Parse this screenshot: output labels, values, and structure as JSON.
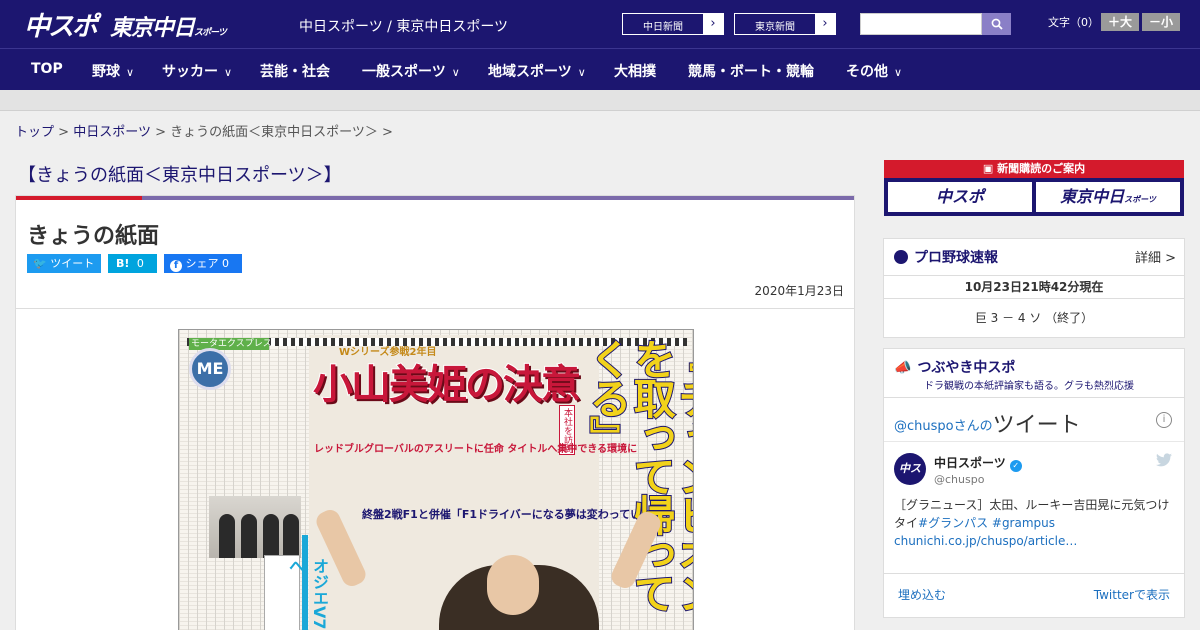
{
  "header": {
    "logo_main": "中スポ",
    "logo_sub": "東京中日",
    "logo_sub_small": "スポーツ",
    "tagline": "中日スポーツ / 東京中日スポーツ",
    "ext_links": [
      {
        "label": "中日新聞"
      },
      {
        "label": "東京新聞"
      }
    ],
    "search_placeholder": "",
    "font_size_label": "文字（0）",
    "font_larger": "＋大",
    "font_smaller": "－小"
  },
  "nav": {
    "items": [
      {
        "label": "TOP",
        "dropdown": false
      },
      {
        "label": "野球",
        "dropdown": true
      },
      {
        "label": "サッカー",
        "dropdown": true
      },
      {
        "label": "芸能・社会",
        "dropdown": false
      },
      {
        "label": "一般スポーツ",
        "dropdown": true
      },
      {
        "label": "地域スポーツ",
        "dropdown": true
      },
      {
        "label": "大相撲",
        "dropdown": false
      },
      {
        "label": "競馬・ボート・競輪",
        "dropdown": false
      },
      {
        "label": "その他",
        "dropdown": true
      }
    ]
  },
  "breadcrumb": {
    "top": "トップ",
    "sep": ">",
    "section": "中日スポーツ",
    "current": "きょうの紙面＜東京中日スポーツ＞",
    "trail_end": ">"
  },
  "page_title": "【きょうの紙面＜東京中日スポーツ＞】",
  "article": {
    "title": "きょうの紙面",
    "share": {
      "tweet": "ツイート",
      "hatena_label": "B!",
      "hatena_count": "0",
      "facebook_label": "シェア",
      "facebook_count": "0"
    },
    "date": "2020年1月23日",
    "paper": {
      "tag": "モータエクスプレス",
      "series": "Wシリーズ参戦2年目",
      "headline": "小山美姫の決意",
      "vertical_headline": "『チャンピオンを取って帰ってくる』",
      "sub1": "レッドブルグローバルのアスリートに任命 タイトルへ集中できる環境に",
      "sub2": "終盤2戦F1と併催「F1ドライバーになる夢は変わっていない」",
      "redbox": "本社を訪問",
      "side_headline": "オジエV7へ"
    }
  },
  "sidebar": {
    "ad": {
      "top": "新聞購読のご案内",
      "left": "中スポ",
      "right": "東京中日",
      "right_small": "スポーツ"
    },
    "baseball": {
      "title": "プロ野球速報",
      "more": "詳細 >",
      "timestamp": "10月23日21時42分現在",
      "score": "巨 3 － 4 ソ （終了）"
    },
    "tweets": {
      "title": "つぶやき中スポ",
      "subtitle": "ドラ観戦の本紙評論家も語る。グラも熱烈応援",
      "handle_link": "@chuspo",
      "handle_suffix": "さんの",
      "heading": "ツイート",
      "info": "i",
      "avatar_text": "中スポ",
      "user_name": "中日スポーツ",
      "user_handle": "@chuspo",
      "text_plain": "［グラニュース］太田、ルーキー吉田晃に元気つけタイ",
      "text_hashtags": "#グランパス #grampus",
      "text_link": "chunichi.co.jp/chuspo/article…",
      "embed": "埋め込む",
      "view_on_twitter": "Twitterで表示"
    }
  }
}
